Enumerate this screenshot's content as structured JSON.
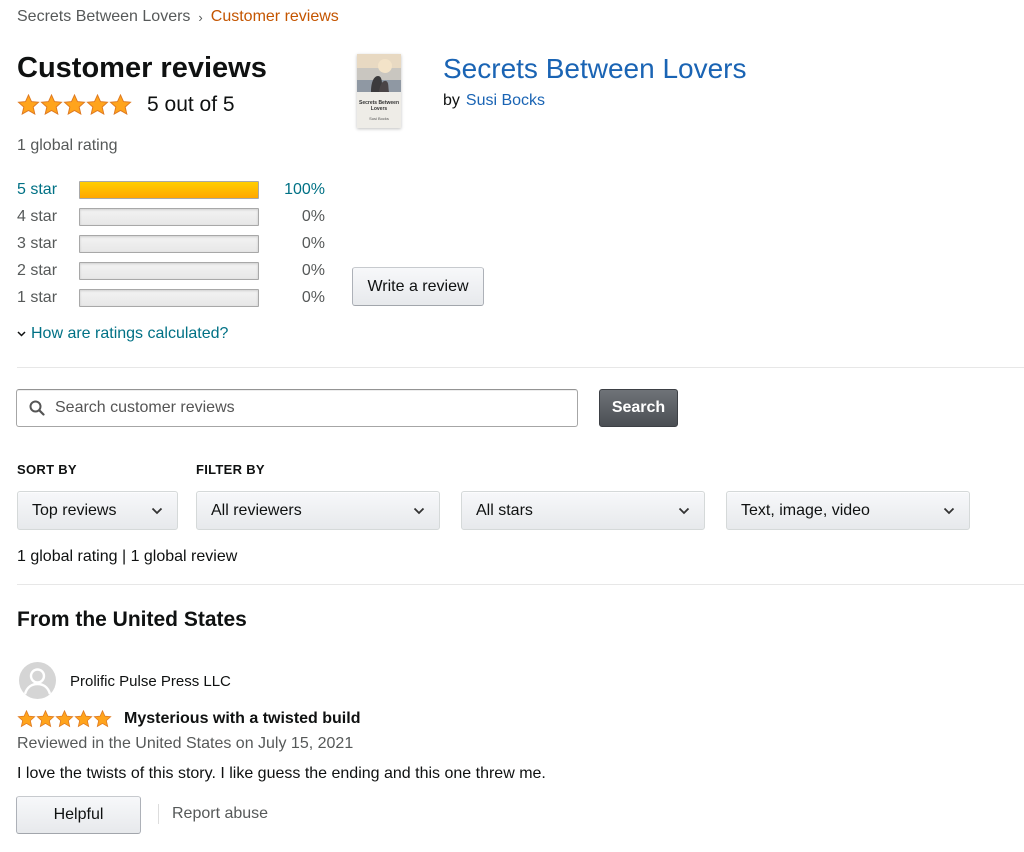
{
  "breadcrumb": {
    "parent": "Secrets Between Lovers",
    "separator": "›",
    "current": "Customer reviews"
  },
  "header": {
    "title": "Customer reviews",
    "rating": 5,
    "rating_text": "5 out of 5",
    "global_rating": "1 global rating"
  },
  "histogram": [
    {
      "label": "5 star",
      "percent_text": "100%",
      "fraction": 1.0
    },
    {
      "label": "4 star",
      "percent_text": "0%",
      "fraction": 0
    },
    {
      "label": "3 star",
      "percent_text": "0%",
      "fraction": 0
    },
    {
      "label": "2 star",
      "percent_text": "0%",
      "fraction": 0
    },
    {
      "label": "1 star",
      "percent_text": "0%",
      "fraction": 0
    }
  ],
  "how_calculated": "How are ratings calculated?",
  "product": {
    "title": "Secrets Between Lovers",
    "by": "by",
    "author": "Susi Bocks",
    "cover_title": "Secrets Between Lovers",
    "cover_author": "Susi Bocks"
  },
  "write_review_label": "Write a review",
  "search": {
    "placeholder": "Search customer reviews",
    "button_label": "Search"
  },
  "sort": {
    "label": "SORT BY",
    "selected": "Top reviews"
  },
  "filter": {
    "label": "FILTER BY",
    "reviewers": "All reviewers",
    "stars": "All stars",
    "format": "Text, image, video"
  },
  "counts_text": "1 global rating | 1 global review",
  "from_heading": "From the United States",
  "review": {
    "reviewer": "Prolific Pulse Press LLC",
    "rating": 5,
    "title": "Mysterious with a twisted build",
    "date": "Reviewed in the United States on July 15, 2021",
    "body": "I love the twists of this story. I like guess the ending and this one threw me.",
    "helpful_label": "Helpful",
    "report_label": "Report abuse"
  },
  "colors": {
    "star": "#ffa41c",
    "link": "#007185",
    "title_blue": "#1a64b4",
    "accent_orange": "#c45500"
  }
}
